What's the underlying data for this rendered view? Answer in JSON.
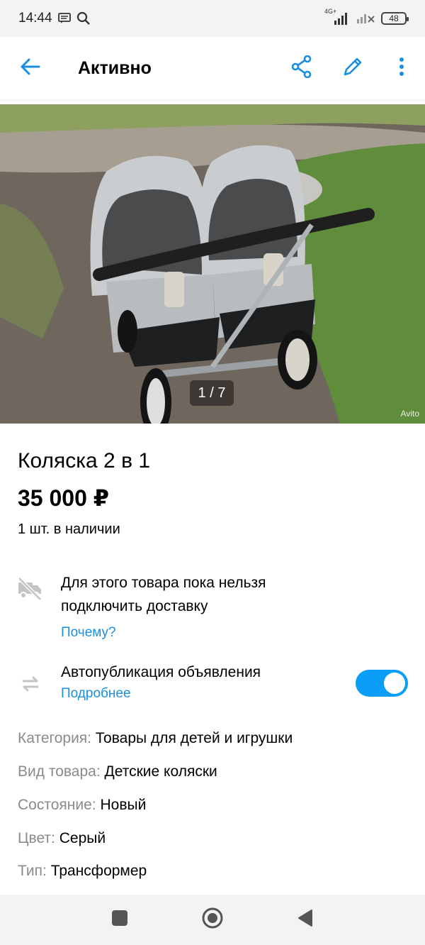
{
  "status_bar": {
    "time": "14:44",
    "network": "4G+",
    "battery": "48"
  },
  "app_bar": {
    "title": "Активно",
    "icons": [
      "arrow-back-icon",
      "share-icon",
      "edit-pencil-icon",
      "more-vertical-icon"
    ]
  },
  "gallery": {
    "counter": "1 / 7",
    "watermark": "Avito"
  },
  "product": {
    "title": "Коляска 2 в 1",
    "price": "35 000 ₽",
    "stock": "1 шт. в наличии"
  },
  "delivery": {
    "line1": "Для этого товара пока нельзя",
    "line2": "подключить доставку",
    "link": "Почему?"
  },
  "autopublish": {
    "label": "Автопубликация объявления",
    "link": "Подробнее",
    "enabled": true
  },
  "attributes": [
    {
      "key": "Категория:",
      "value": "Товары для детей и игрушки"
    },
    {
      "key": "Вид товара:",
      "value": "Детские коляски"
    },
    {
      "key": "Состояние:",
      "value": "Новый"
    },
    {
      "key": "Цвет:",
      "value": "Серый"
    },
    {
      "key": "Тип:",
      "value": "Трансформер"
    }
  ],
  "colors": {
    "accent": "#1a8fe0",
    "toggle": "#0a9ef6"
  }
}
